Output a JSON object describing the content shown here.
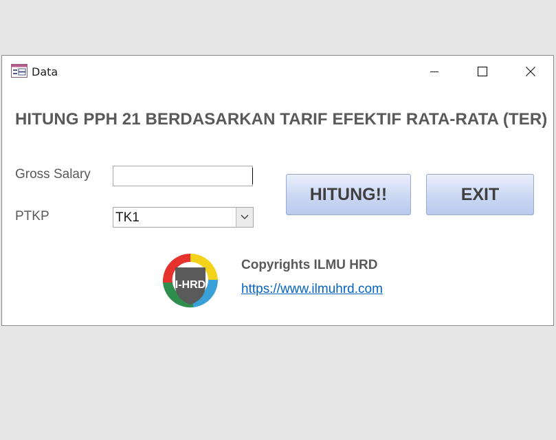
{
  "window": {
    "title": "Data",
    "controls": {
      "minimize": "minimize-icon",
      "maximize": "maximize-icon",
      "close": "close-icon"
    }
  },
  "form": {
    "heading": "HITUNG PPH 21 BERDASARKAN TARIF EFEKTIF RATA-RATA (TER)",
    "gross_salary": {
      "label": "Gross Salary",
      "value": ""
    },
    "ptkp": {
      "label": "PTKP",
      "selected": "TK1"
    }
  },
  "buttons": {
    "hitung": "HITUNG!!",
    "exit": "EXIT"
  },
  "footer": {
    "logo_text": "I-HRD",
    "copyright": "Copyrights ILMU HRD",
    "link": "https://www.ilmuhrd.com"
  },
  "colors": {
    "heading": "#595959",
    "button_top": "#e8eefa",
    "button_bottom": "#b9c9ee",
    "link": "#0563c1"
  }
}
